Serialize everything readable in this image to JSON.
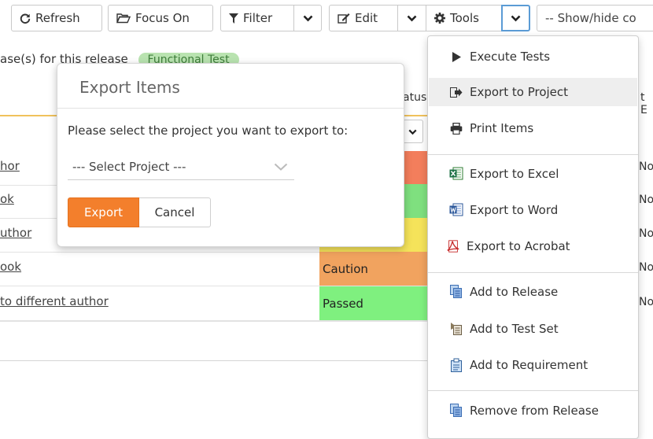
{
  "toolbar": {
    "refresh": "Refresh",
    "focus_on": "Focus On",
    "filter": "Filter",
    "edit": "Edit",
    "tools": "Tools",
    "show_hide": "-- Show/hide co"
  },
  "grid": {
    "note_prefix": "ase(s) fo",
    "note_hidden": "r this release",
    "filter_pill": "Functional Test",
    "status_header": "atus",
    "right_header": "t E",
    "rows": [
      {
        "link": "hor",
        "status": "",
        "status_color": "#f37e5c",
        "right": "No"
      },
      {
        "link": "ok",
        "status": "",
        "status_color": "#7fe07f",
        "right": "No"
      },
      {
        "link": "uthor",
        "status": "",
        "status_color": "#f5e35a",
        "right": "No"
      },
      {
        "link": "ook",
        "status": "Caution",
        "status_color": "#f1a35f",
        "right": "No"
      },
      {
        "link": "to different author",
        "status": "Passed",
        "status_color": "#7ff07f",
        "right": "No"
      }
    ]
  },
  "modal": {
    "title": "Export Items",
    "message": "Please select the project you want to export to:",
    "select_placeholder": "--- Select Project ---",
    "export_label": "Export",
    "cancel_label": "Cancel"
  },
  "tools_menu": {
    "execute_tests": "Execute Tests",
    "export_to_project": "Export to Project",
    "print_items": "Print Items",
    "export_excel": "Export to Excel",
    "export_word": "Export to Word",
    "export_acrobat": "Export to Acrobat",
    "add_release": "Add to Release",
    "add_test_set": "Add to Test Set",
    "add_requirement": "Add to Requirement",
    "remove_release": "Remove from Release"
  },
  "colors": {
    "accent_orange": "#f37f2c",
    "focus_blue": "#5b9bd5"
  }
}
